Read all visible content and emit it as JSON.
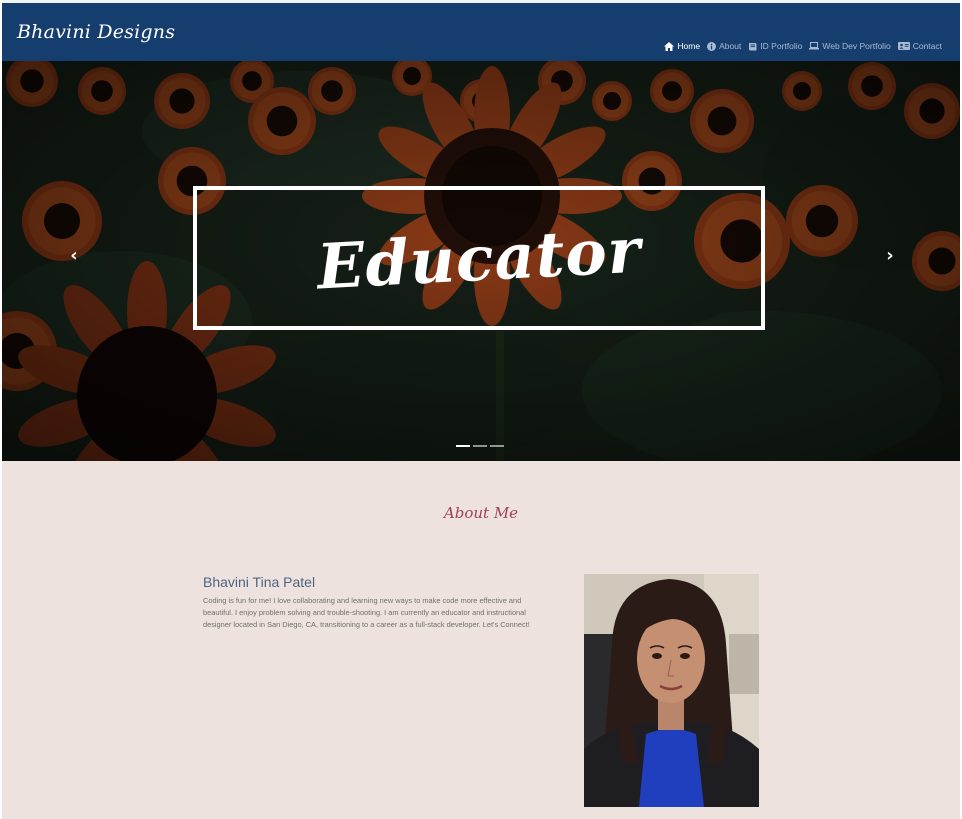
{
  "navbar": {
    "brand": "Bhavini Designs",
    "items": [
      {
        "label": "Home",
        "icon": "home-icon",
        "active": true
      },
      {
        "label": "About",
        "icon": "info-circle-icon",
        "active": false
      },
      {
        "label": "ID Portfolio",
        "icon": "book-icon",
        "active": false
      },
      {
        "label": "Web Dev Portfolio",
        "icon": "laptop-icon",
        "active": false
      },
      {
        "label": "Contact",
        "icon": "address-card-icon",
        "active": false
      }
    ]
  },
  "hero": {
    "caption": "Educator",
    "prev_icon": "chevron-left-icon",
    "next_icon": "chevron-right-icon",
    "prev_glyph": "‹",
    "next_glyph": "›",
    "slide_count": 3,
    "active_slide": 1
  },
  "about": {
    "heading": "About Me",
    "name": "Bhavini Tina Patel",
    "bio": "Coding is fun for me! I love collaborating and learning new ways to make code more effective and beautiful. I enjoy problem solving and trouble-shooting. I am currently an educator and instructional designer located in San Diego, CA, transitioning to a career as a full-stack developer. Let's Connect!"
  },
  "colors": {
    "navbar": "#153e6e",
    "page_background": "#ede2dd",
    "heading_accent": "#a0405b",
    "name_text": "#4d6582"
  }
}
